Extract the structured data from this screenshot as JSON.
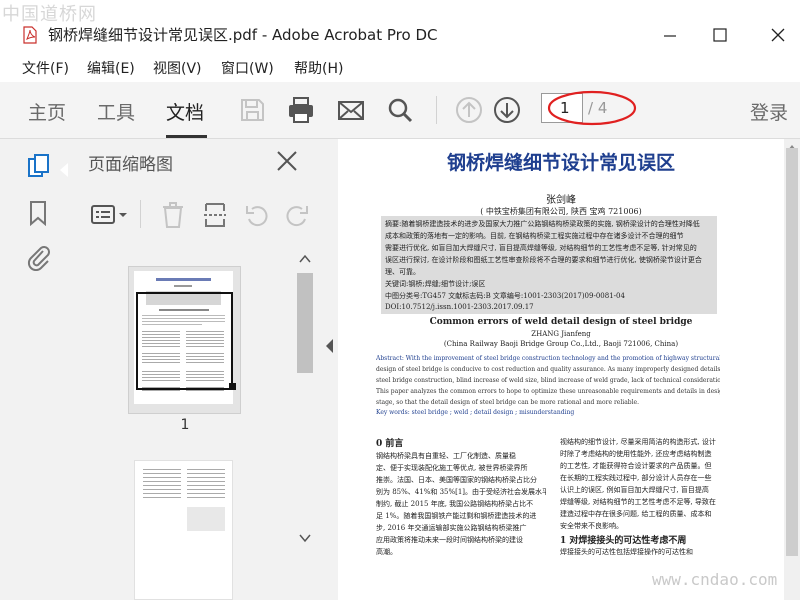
{
  "watermark_top": "中国道桥网",
  "window": {
    "title": "钢桥焊缝细节设计常见误区.pdf - Adobe Acrobat Pro DC"
  },
  "menu": [
    "文件(F)",
    "编辑(E)",
    "视图(V)",
    "窗口(W)",
    "帮助(H)"
  ],
  "toolbar": {
    "tabs": [
      "主页",
      "工具",
      "文档"
    ],
    "active_tab": "文档",
    "page_current": "1",
    "page_total": "/ 4",
    "login": "登录"
  },
  "pane": {
    "title": "页面缩略图",
    "thumb1_label": "1"
  },
  "document": {
    "title": "钢桥焊缝细节设计常见误区",
    "author": "张剑峰",
    "affiliation": "( 中铁宝桥集团有限公司, 陕西  宝鸡  721006)",
    "abstract_lines": [
      "摘要:随着钢桥建造技术的进步及国家大力推广公路钢结构桥梁政策的实施, 钢桥梁设计的合理性对降低",
      "成本和政策的落地有一定的影响。目前, 在钢结构桥梁工程实施过程中存在诸多设计不合理的细节",
      "需要进行优化, 如盲目加大焊缝尺寸, 盲目提高焊缝等级, 对结构细节的工艺性考虑不足等, 针对常见的",
      "误区进行探讨, 在设计阶段和图纸工艺性审查阶段将不合理的要求和细节进行优化, 使钢桥梁节设计更合",
      "理、可靠。",
      "关键词:钢桥;焊缝;细节设计;误区",
      "中图分类号:TG457        文献标志码:B         文章编号:1001-2303(2017)09-0081-04",
      "DOI:10.7512/j.issn.1001-2303.2017.09.17"
    ],
    "en_title": "Common errors of weld detail design of steel bridge",
    "en_author": "ZHANG Jianfeng",
    "en_affiliation": "(China Railway Baoji Bridge Group Co.,Ltd., Baoji 721006, China)",
    "en_abstract_lines": [
      "Abstract: With the improvement of steel bridge construction technology and the promotion of highway structural steel bridge,the rational",
      "design of steel bridge is conducive to cost reduction and quality assurance. As many improperly designed details are currently existed in",
      "steel bridge construction, blind increase of weld size, blind increase of weld grade, lack of technical consideration of structural details, etc.",
      "This paper analyzes the common errors to hope to optimize these unreasonable requirements and details in design stage and drawing review",
      "stage, so that the detail design of steel bridge can be more rational and more reliable."
    ],
    "keywords_en": "Key words: steel bridge ; weld ; detail design ; misunderstanding",
    "sec0_heading": "0   前言",
    "left_col": [
      "     钢结构桥梁具有自重轻、工厂化制造、质量稳",
      "定、便于实现装配化施工等优点, 被世界桥梁界所",
      "推崇。法国、日本、美国等国家的钢结构桥梁占比分",
      "别为 85%、41%和 35%[1]。由于受经济社会发展水平",
      "制约, 截止 2015 年底, 我国公路钢结构桥梁占比不",
      "足 1%。随着我国钢铁产能过剩和钢桥建造技术的进",
      "步, 2016 年交通运输部实施公路钢结构桥梁推广",
      "应用政策将推动未来一段时间钢结构桥梁的建设",
      "高潮。"
    ],
    "right_col": [
      "视结构的细节设计, 尽量采用简洁的构造形式, 设计",
      "时除了考虑结构的使用性能外, 还应考虑结构制造",
      "的工艺性, 才能获得符合设计要求的产品质量。但",
      "在长期的工程实践过程中, 部分设计人员存在一些",
      "认识上的误区, 例如盲目加大焊缝尺寸, 盲目提高",
      "焊缝等级, 对结构细节的工艺性考虑不足等, 导致在",
      "建造过程中存在很多问题, 给工程的质量、成本和",
      "安全带来不良影响。"
    ],
    "sec1_heading": "1   对焊接接头的可达性考虑不周",
    "sec1_first": "焊接接头的可达性包括焊接操作的可达性和"
  },
  "watermark_bottom": "www.cndao.com"
}
